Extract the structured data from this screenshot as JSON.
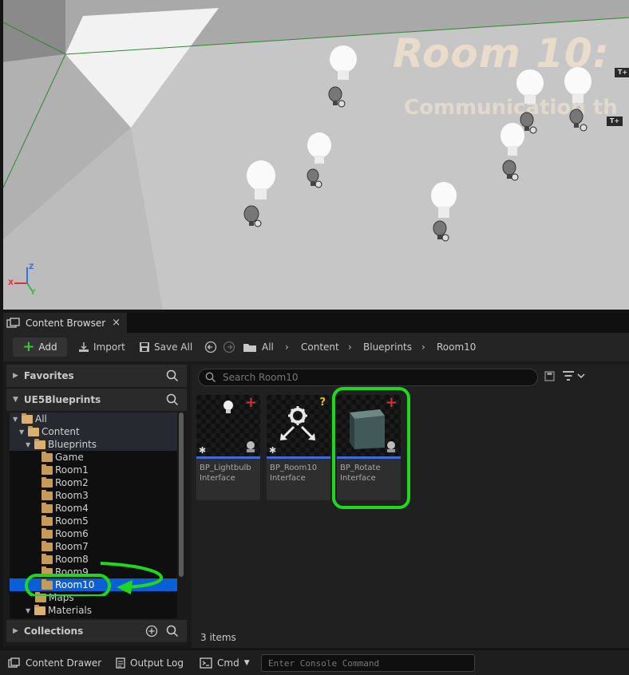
{
  "viewport": {
    "title_text": "Room 10:",
    "subtitle_text": "Communication th",
    "text_tag": "T+",
    "axis": {
      "z": "Z",
      "x": "X",
      "y": "Y"
    }
  },
  "content_browser": {
    "tab_label": "Content Browser",
    "tab_close": "×",
    "toolbar": {
      "add_label": "Add",
      "import_label": "Import",
      "save_all_label": "Save All"
    },
    "breadcrumbs": [
      "All",
      "Content",
      "Blueprints",
      "Room10"
    ],
    "sidebar": {
      "favorites_label": "Favorites",
      "project_label": "UE5Blueprints",
      "collections_label": "Collections",
      "tree": [
        "All",
        "Content",
        "Blueprints",
        "Game",
        "Room1",
        "Room2",
        "Room3",
        "Room4",
        "Room5",
        "Room6",
        "Room7",
        "Room8",
        "Room9",
        "Room10",
        "Maps",
        "Materials"
      ],
      "selected": "Room10"
    },
    "search_placeholder": "Search Room10",
    "assets": [
      {
        "name": "BP_Lightbulb Interface",
        "badge": "+"
      },
      {
        "name": "BP_Room10 Interface",
        "badge": "?"
      },
      {
        "name": "BP_Rotate Interface",
        "badge": "+"
      }
    ],
    "item_count": "3 items",
    "colors": {
      "highlight": "#1ed81e",
      "selection": "#0b5fd6",
      "asset_bar": "#3d6bdb"
    }
  },
  "statusbar": {
    "content_drawer_label": "Content Drawer",
    "output_log_label": "Output Log",
    "cmd_label": "Cmd",
    "console_placeholder": "Enter Console Command"
  }
}
